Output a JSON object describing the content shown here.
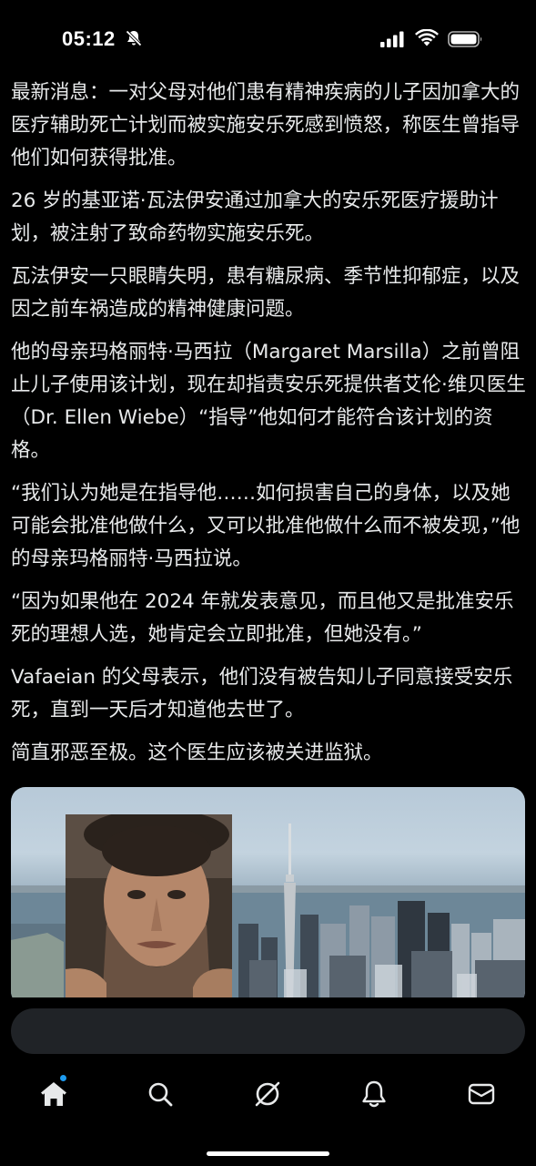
{
  "status_bar": {
    "time": "05:12",
    "icons": [
      "bell-slash-icon",
      "cellular-signal-icon",
      "wifi-icon",
      "battery-icon"
    ]
  },
  "post": {
    "paragraphs": [
      "最新消息：一对父母对他们患有精神疾病的儿子因加拿大的医疗辅助死亡计划而被实施安乐死感到愤怒，称医生曾指导他们如何获得批准。",
      "26 岁的基亚诺·瓦法伊安通过加拿大的安乐死医疗援助计划，被注射了致命药物实施安乐死。",
      "瓦法伊安一只眼睛失明，患有糖尿病、季节性抑郁症，以及因之前车祸造成的精神健康问题。",
      "他的母亲玛格丽特·马西拉（Margaret Marsilla）之前曾阻止儿子使用该计划，现在却指责安乐死提供者艾伦·维贝医生（Dr. Ellen Wiebe）“指导”他如何才能符合该计划的资格。",
      "“我们认为她是在指导他……如何损害自己的身体，以及她可能会批准他做什么，又可以批准他做什么而不被发现，”他的母亲玛格丽特·马西拉说。",
      "“因为如果他在 2024 年就发表意见，而且他又是批准安乐死的理想人选，她肯定会立即批准，但她没有。”",
      "Vafaeian 的父母表示，他们没有被告知儿子同意接受安乐死，直到一天后才知道他去世了。",
      "简直邪恶至极。这个医生应该被关进监狱。"
    ]
  },
  "reply": {
    "placeholder": "",
    "value": ""
  },
  "tab_bar": {
    "items": [
      "home-icon",
      "search-icon",
      "grok-icon",
      "notifications-icon",
      "messages-icon"
    ],
    "active": "home-icon",
    "accent_color": "#1d9bf0"
  },
  "colors": {
    "background": "#000000",
    "text": "#e7e9ea",
    "input_bg": "#202327"
  }
}
